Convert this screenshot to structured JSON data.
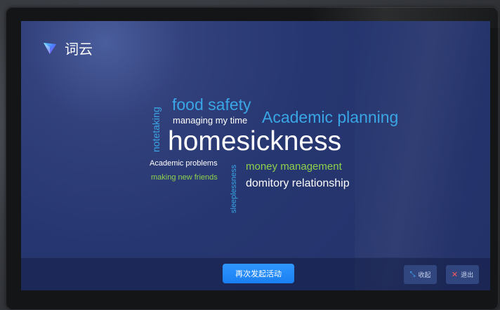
{
  "app": {
    "title": "词云"
  },
  "colors": {
    "blue": "#3aa6e6",
    "white": "#ffffff",
    "green": "#8ed24c",
    "primary": "#1a7ff2"
  },
  "cloud": {
    "words": [
      {
        "text": "food safety",
        "color": "blue"
      },
      {
        "text": "managing my time",
        "color": "white"
      },
      {
        "text": "Academic planning",
        "color": "blue"
      },
      {
        "text": "homesickness",
        "color": "white"
      },
      {
        "text": "notetaking",
        "color": "blue"
      },
      {
        "text": "Academic problems",
        "color": "white"
      },
      {
        "text": "making new friends",
        "color": "green"
      },
      {
        "text": "sleeplessness",
        "color": "blue"
      },
      {
        "text": "money management",
        "color": "green"
      },
      {
        "text": "domitory relationship",
        "color": "white"
      }
    ]
  },
  "footer": {
    "restart_label": "再次发起活动",
    "minimize_label": "收起",
    "exit_label": "退出",
    "minimize_icon": "minimize-icon",
    "exit_icon": "close-icon"
  }
}
